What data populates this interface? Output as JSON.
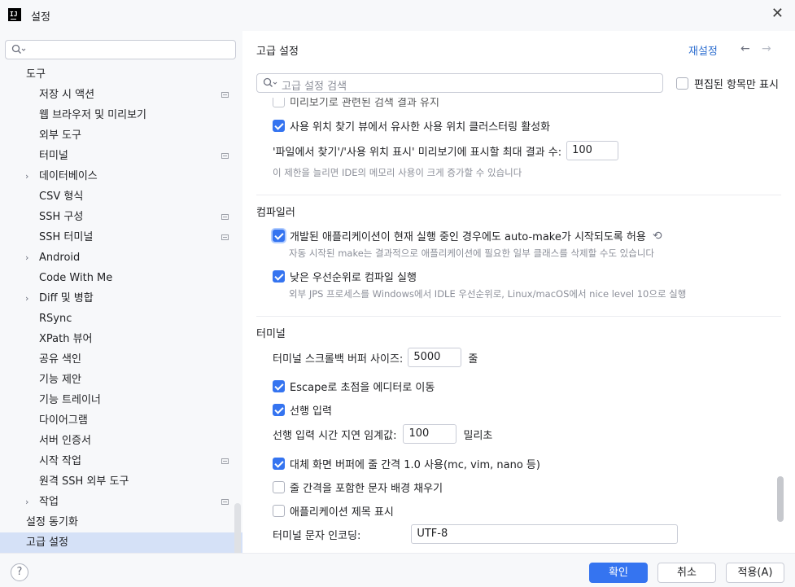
{
  "window": {
    "title": "설정",
    "app_icon": "IJ"
  },
  "left": {
    "search_placeholder": "",
    "tree": [
      {
        "label": "도구",
        "level": 0
      },
      {
        "label": "저장 시 액션",
        "level": 1,
        "mini": true
      },
      {
        "label": "웹 브라우저 및 미리보기",
        "level": 1
      },
      {
        "label": "외부 도구",
        "level": 1
      },
      {
        "label": "터미널",
        "level": 1,
        "mini": true
      },
      {
        "label": "데이터베이스",
        "level": 1,
        "arrow": true
      },
      {
        "label": "CSV 형식",
        "level": 1
      },
      {
        "label": "SSH 구성",
        "level": 1,
        "mini": true
      },
      {
        "label": "SSH 터미널",
        "level": 1,
        "mini": true
      },
      {
        "label": "Android",
        "level": 1,
        "arrow": true
      },
      {
        "label": "Code With Me",
        "level": 1
      },
      {
        "label": "Diff 및 병합",
        "level": 1,
        "arrow": true
      },
      {
        "label": "RSync",
        "level": 1
      },
      {
        "label": "XPath 뷰어",
        "level": 1
      },
      {
        "label": "공유 색인",
        "level": 1
      },
      {
        "label": "기능 제안",
        "level": 1
      },
      {
        "label": "기능 트레이너",
        "level": 1
      },
      {
        "label": "다이어그램",
        "level": 1
      },
      {
        "label": "서버 인증서",
        "level": 1
      },
      {
        "label": "시작 작업",
        "level": 1,
        "mini": true
      },
      {
        "label": "원격 SSH 외부 도구",
        "level": 1
      },
      {
        "label": "작업",
        "level": 1,
        "arrow": true,
        "mini": true
      },
      {
        "label": "설정 동기화",
        "level": 0
      },
      {
        "label": "고급 설정",
        "level": 0,
        "selected": true
      }
    ]
  },
  "right": {
    "title": "고급 설정",
    "reset": "재설정",
    "back_arrow": "←",
    "forward_arrow": "→",
    "search_placeholder": "고급 설정 검색",
    "edited_only_label": "편집된 항목만 표시",
    "partial_item": "미리보기로 관련된 검색 결과 유지",
    "usage_cluster": "사용 위치 찾기 뷰에서 유사한 사용 위치 클러스터링 활성화",
    "max_results_label": "'파일에서 찾기'/'사용 위치 표시' 미리보기에 표시할 최대 결과 수:",
    "max_results_value": "100",
    "max_results_hint": "이 제한을 늘리면 IDE의 메모리 사용이 크게 증가할 수 있습니다",
    "compiler_title": "컴파일러",
    "automake_label": "개발된 애플리케이션이 현재 실행 중인 경우에도 auto-make가 시작되도록 허용",
    "automake_hint": "자동 시작된 make는 결과적으로 애플리케이션에 필요한 일부 클래스를 삭제할 수도 있습니다",
    "low_priority_label": "낮은 우선순위로 컴파일 실행",
    "low_priority_hint": "외부 JPS 프로세스를 Windows에서 IDLE 우선순위로, Linux/macOS에서 nice level 10으로 실행",
    "terminal_title": "터미널",
    "scrollback_label": "터미널 스크롤백 버퍼 사이즈:",
    "scrollback_value": "5000",
    "scrollback_unit": "줄",
    "escape_label": "Escape로 초점을 에디터로 이동",
    "typeahead_label": "선행 입력",
    "typeahead_delay_label": "선행 입력 시간 지연 임계값:",
    "typeahead_delay_value": "100",
    "typeahead_delay_unit": "밀리초",
    "alt_buffer_label": "대체 화면 버퍼에 줄 간격 1.0 사용(mc, vim, nano 등)",
    "fill_bg_label": "줄 간격을 포함한 문자 배경 채우기",
    "app_title_label": "애플리케이션 제목 표시",
    "encoding_label": "터미널 문자 인코딩:",
    "encoding_value": "UTF-8"
  },
  "footer": {
    "help": "?",
    "ok": "확인",
    "cancel": "취소",
    "apply": "적용(A)"
  },
  "colors": {
    "accent": "#3574f0",
    "link": "#2f6fd0",
    "selection": "#d5e1f7"
  }
}
